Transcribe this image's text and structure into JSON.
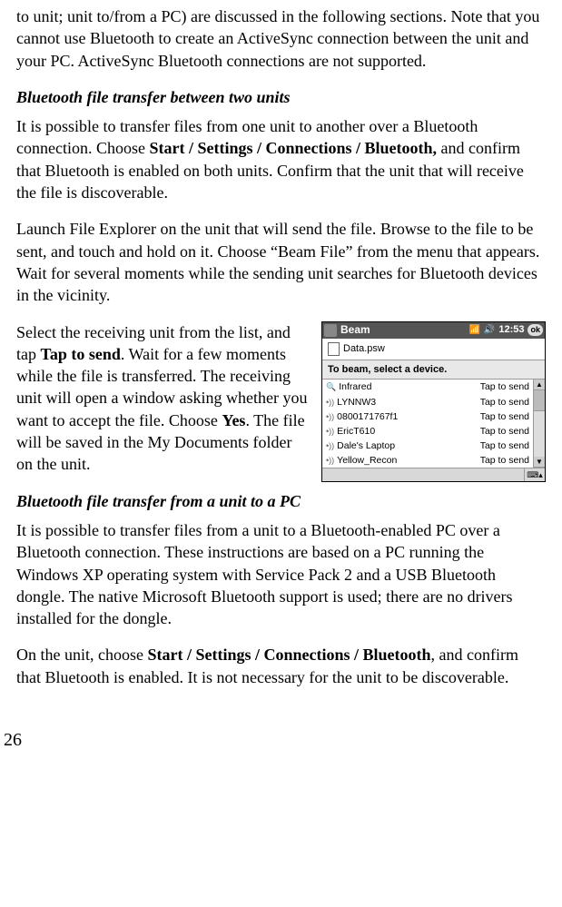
{
  "intro": "to unit; unit to/from a PC) are discussed in the following sections. Note that you cannot use Bluetooth to create an ActiveSync connection between the unit and your PC. ActiveSync Bluetooth connections are not supported.",
  "s1": {
    "heading": "Bluetooth file transfer between two units",
    "p1_a": "It is possible to transfer files from one unit to another over a Bluetooth connection. Choose ",
    "p1_b": "Start / Settings / Connections / Bluetooth,",
    "p1_c": " and confirm that Bluetooth is enabled on both units. Confirm that the unit that will receive the file is discoverable.",
    "p2": "Launch File Explorer on the unit that will send the file. Browse to the file to be sent, and touch and hold on it. Choose “Beam File” from the menu that appears. Wait for several moments while the sending unit searches for Bluetooth devices in the vicinity.",
    "p3_a": "Select the receiving unit from the list, and tap ",
    "p3_b": "Tap to send",
    "p3_c": ". Wait for a few moments while the file is transferred. The receiving unit will open a window asking whether you want to accept the file. Choose ",
    "p3_d": "Yes",
    "p3_e": ". The file will be saved in the My Documents folder on the unit."
  },
  "screenshot": {
    "title": "Beam",
    "time": "12:53",
    "ok": "ok",
    "file": "Data.psw",
    "instruction": "To beam, select a device.",
    "action": "Tap to send",
    "devices": [
      {
        "icon": "search",
        "name": "Infrared"
      },
      {
        "icon": "bt",
        "name": "LYNNW3"
      },
      {
        "icon": "bt",
        "name": "0800171767f1"
      },
      {
        "icon": "bt",
        "name": "EricT610"
      },
      {
        "icon": "bt",
        "name": "Dale's Laptop"
      },
      {
        "icon": "bt",
        "name": "Yellow_Recon"
      }
    ]
  },
  "s2": {
    "heading": "Bluetooth file transfer from a unit to a PC",
    "p1": "It is possible to transfer files from a unit to a Bluetooth-enabled PC over a Bluetooth connection. These instructions are based on a PC running the Windows XP operating system with Service Pack 2 and a USB Bluetooth dongle. The native Microsoft Bluetooth support is used; there are no drivers installed for the dongle.",
    "p2_a": "On the unit, choose ",
    "p2_b": "Start / Settings / Connections / Bluetooth",
    "p2_c": ", and confirm that Bluetooth is enabled. It is not necessary for the unit to be discoverable."
  },
  "page_number": "26"
}
